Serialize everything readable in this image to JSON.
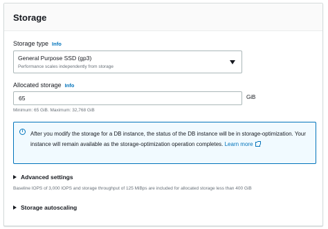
{
  "panel": {
    "title": "Storage"
  },
  "storage_type": {
    "label": "Storage type",
    "info": "Info",
    "selected": "General Purpose SSD (gp3)",
    "description": "Performance scales independently from storage"
  },
  "allocated_storage": {
    "label": "Allocated storage",
    "info": "Info",
    "value": "65",
    "unit": "GiB",
    "constraint": "Minimum: 65 GiB. Maximum: 32,768 GiB"
  },
  "alert": {
    "icon": "info-icon",
    "text": "After you modify the storage for a DB instance, the status of the DB instance will be in storage-optimization. Your instance will remain available as the storage-optimization operation completes.",
    "link": "Learn more"
  },
  "advanced_settings": {
    "label": "Advanced settings",
    "description": "Baseline IOPS of 3,000 IOPS and storage throughput of 125 MiBps are included for allocated storage less than 400 GiB"
  },
  "storage_autoscaling": {
    "label": "Storage autoscaling"
  },
  "colors": {
    "accent": "#0073bb",
    "alert_bg": "#f1faff",
    "text": "#16191f",
    "muted": "#687078"
  }
}
